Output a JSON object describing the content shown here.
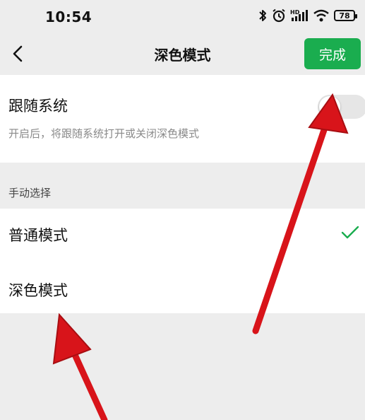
{
  "status": {
    "time": "10:54",
    "battery": "78",
    "icons": [
      "bluetooth-icon",
      "alarm-icon",
      "hd-signal-icon",
      "wifi-icon",
      "battery-icon"
    ]
  },
  "nav": {
    "title": "深色模式",
    "done_label": "完成",
    "back_icon": "chevron-left-icon"
  },
  "follow_system": {
    "title": "跟随系统",
    "description": "开启后，将跟随系统打开或关闭深色模式",
    "toggle_on": false
  },
  "manual": {
    "header": "手动选择",
    "options": [
      {
        "label": "普通模式",
        "selected": true
      },
      {
        "label": "深色模式",
        "selected": false
      }
    ]
  },
  "colors": {
    "accent": "#1aad4f",
    "annotation_arrow": "#d8141a"
  }
}
